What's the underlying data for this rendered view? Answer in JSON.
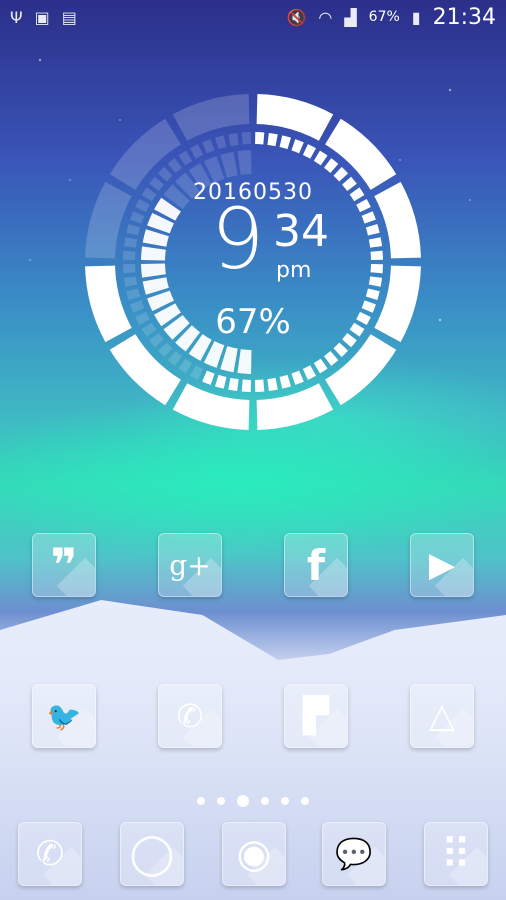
{
  "status_bar": {
    "left_icons": [
      "usb-icon",
      "image-icon",
      "recycle-icon"
    ],
    "right_icons": [
      "mute-icon",
      "wifi-icon",
      "signal-icon",
      "battery-charging-icon"
    ],
    "battery_percent": "67%",
    "time": "21:34"
  },
  "clock_widget": {
    "date": "20160530",
    "hour": "9",
    "minutes": "34",
    "ampm": "pm",
    "battery": "67%",
    "battery_level": 0.67
  },
  "home_apps": [
    {
      "name": "quote-app",
      "icon": "quote-icon",
      "glyph": "❞"
    },
    {
      "name": "google-plus",
      "icon": "google-plus-icon",
      "glyph": "g+"
    },
    {
      "name": "facebook",
      "icon": "facebook-icon",
      "glyph": "f"
    },
    {
      "name": "play-store",
      "icon": "play-icon",
      "glyph": "▶"
    },
    {
      "name": "twitter",
      "icon": "twitter-bird-icon",
      "glyph": "🐦"
    },
    {
      "name": "whatsapp",
      "icon": "phone-bubble-icon",
      "glyph": "✆"
    },
    {
      "name": "flipboard",
      "icon": "flipboard-icon",
      "glyph": "▛"
    },
    {
      "name": "drive",
      "icon": "drive-icon",
      "glyph": "△"
    }
  ],
  "page_indicator": {
    "count": 6,
    "active": 2
  },
  "dock_apps": [
    {
      "name": "phone",
      "icon": "phone-icon",
      "glyph": "✆"
    },
    {
      "name": "camera",
      "icon": "camera-icon",
      "glyph": "◯"
    },
    {
      "name": "chrome",
      "icon": "chrome-icon",
      "glyph": "◉"
    },
    {
      "name": "messaging",
      "icon": "chat-bubble-icon",
      "glyph": "💬"
    },
    {
      "name": "app-drawer",
      "icon": "grid-icon",
      "glyph": "⠿"
    }
  ]
}
